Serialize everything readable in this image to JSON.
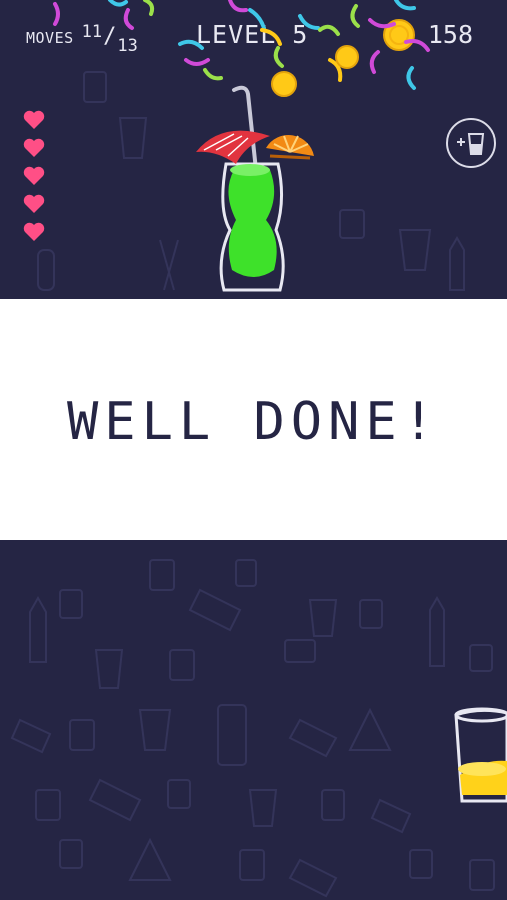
{
  "hud": {
    "moves_label": "MOVES",
    "moves_current": "11",
    "moves_total": "13",
    "level_label": "LEVEL 5",
    "coins": "158"
  },
  "lives": {
    "count": 5
  },
  "banner": {
    "text": "WELL DONE!"
  },
  "icons": {
    "heart": "heart-icon",
    "coin": "coin-icon",
    "add_glass": "add-glass-icon"
  },
  "colors": {
    "background": "#252544",
    "banner": "#ffffff",
    "banner_text": "#252544",
    "heart": "#ff4f86",
    "liquid_green": "#3ee12a",
    "liquid_yellow": "#ffd21a",
    "coin": "#ffc917"
  },
  "side_glass": {
    "fill_level": 0.3
  }
}
